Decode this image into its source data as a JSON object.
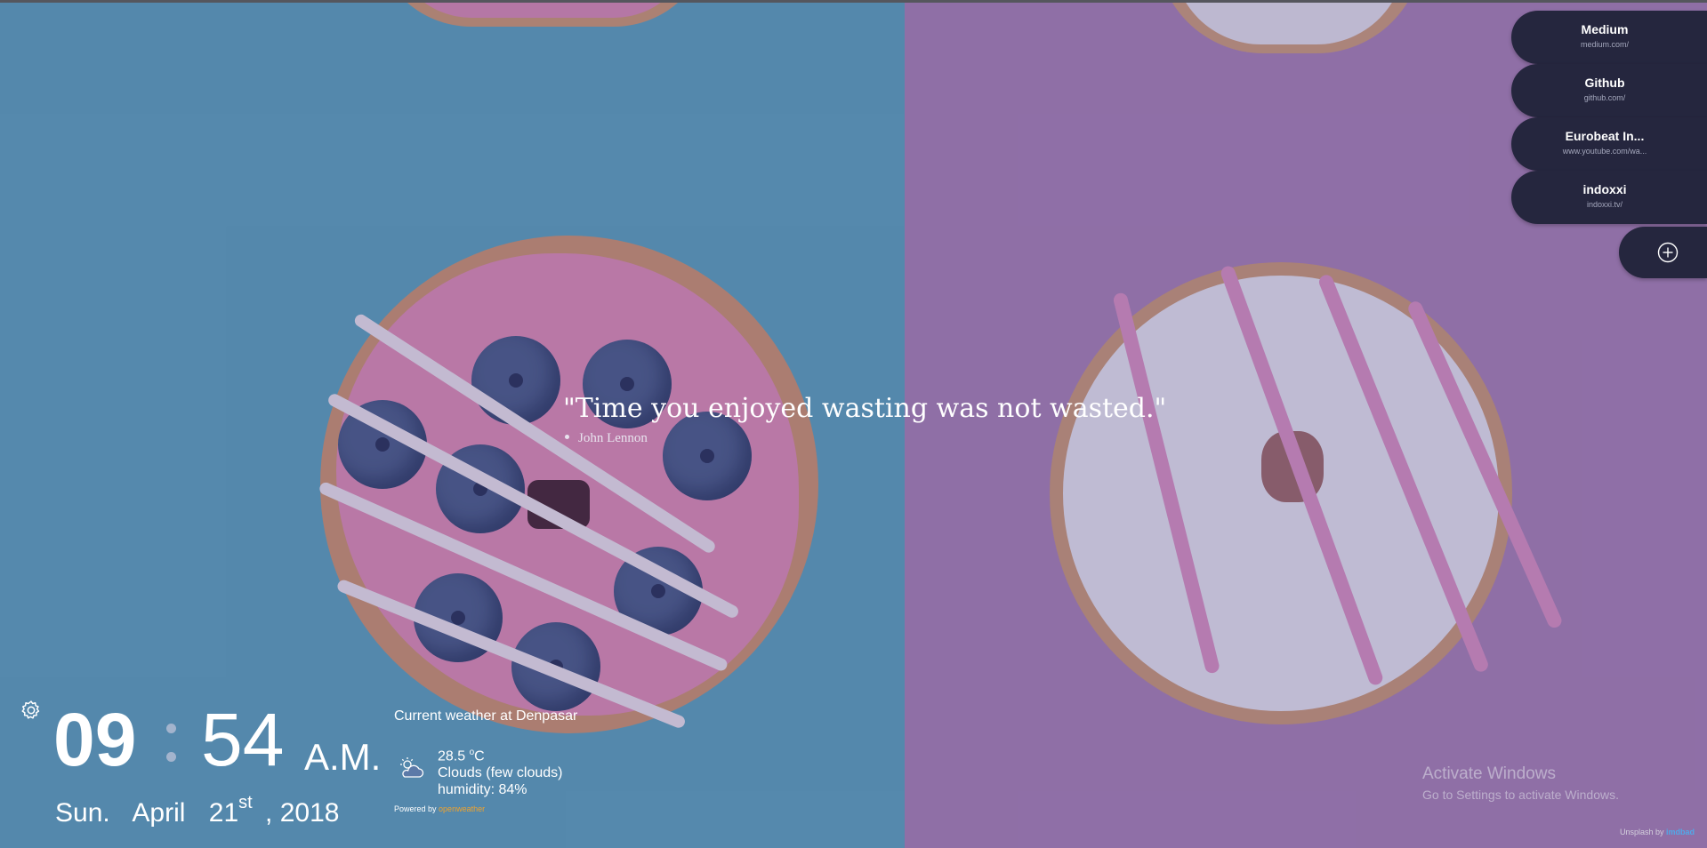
{
  "bookmarks": [
    {
      "title": "Medium",
      "url": "medium.com/"
    },
    {
      "title": "Github",
      "url": "github.com/"
    },
    {
      "title": "Eurobeat In...",
      "url": "www.youtube.com/wa..."
    },
    {
      "title": "indoxxi",
      "url": "indoxxi.tv/"
    }
  ],
  "add_bookmark_icon": "plus-circle-icon",
  "quote": {
    "text": "\"Time you enjoyed wasting was not wasted.\"",
    "author": "John Lennon"
  },
  "settings_icon": "gear-icon",
  "clock": {
    "hours": "09",
    "minutes": "54",
    "ampm": "A.M."
  },
  "date": {
    "weekday": "Sun.",
    "month": "April",
    "day": "21",
    "suffix": "st",
    "year": ", 2018"
  },
  "weather": {
    "title": "Current weather at Denpasar",
    "icon": "cloud-sun-icon",
    "temp": "28.5",
    "unit_deg": "o",
    "unit_c": "C",
    "description": "Clouds (few clouds)",
    "humidity": "humidity: 84%",
    "powered_label": "Powered by",
    "powered_link": "openweather"
  },
  "watermark": {
    "title": "Activate Windows",
    "subtitle": "Go to Settings to activate Windows."
  },
  "credit": {
    "prefix": "Unsplash by",
    "author": "imdbad"
  },
  "colors": {
    "bookmark_bg": "#25263e",
    "left_bg": "#5f9fbf",
    "right_bg": "#a680b8",
    "accent_orange": "#f0a32c",
    "accent_blue": "#52a8e8"
  }
}
